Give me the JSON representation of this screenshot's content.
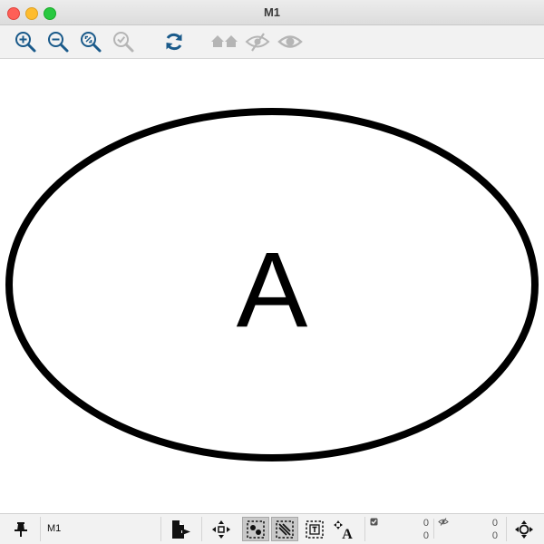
{
  "window": {
    "title": "M1"
  },
  "toolbar": {
    "buttons": [
      {
        "name": "zoom-in",
        "enabled": true
      },
      {
        "name": "zoom-out",
        "enabled": true
      },
      {
        "name": "zoom-fit",
        "enabled": true
      },
      {
        "name": "zoom-selection",
        "enabled": false
      },
      {
        "name": "refresh",
        "enabled": true
      },
      {
        "name": "home",
        "enabled": false
      },
      {
        "name": "hide",
        "enabled": false
      },
      {
        "name": "show",
        "enabled": false
      }
    ]
  },
  "canvas": {
    "node_label": "A",
    "colors": {
      "stroke": "#000000",
      "fill": "#ffffff"
    }
  },
  "status": {
    "model_name": "M1",
    "selected_count_1": "0",
    "selected_count_2": "0",
    "hidden_count_1": "0",
    "hidden_count_2": "0"
  },
  "colors": {
    "accent": "#1a5a8a",
    "disabled": "#b5b5b5"
  }
}
